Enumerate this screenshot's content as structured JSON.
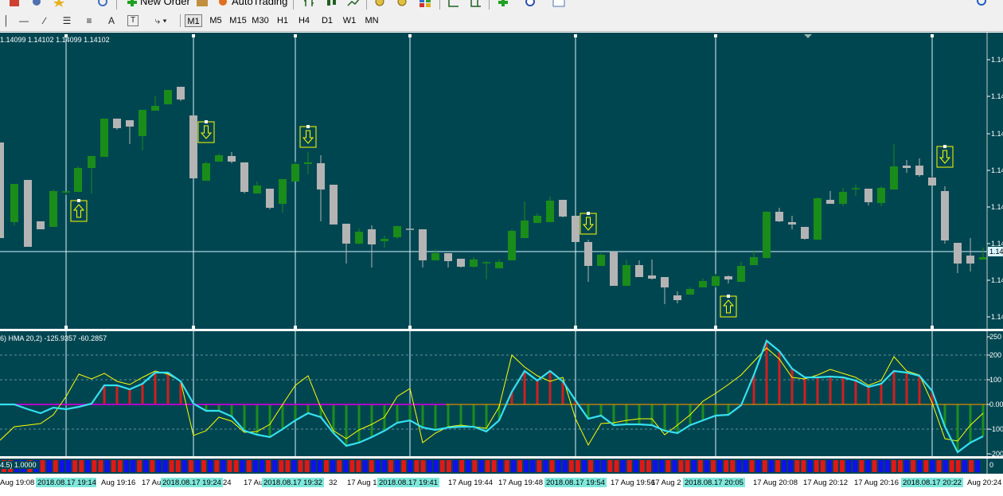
{
  "toolbar_top": {
    "new_order_label": "New Order",
    "auto_trading_label": "AutoTrading"
  },
  "timeframes": [
    {
      "label": "M1",
      "active": true
    },
    {
      "label": "M5",
      "active": false
    },
    {
      "label": "M15",
      "active": false
    },
    {
      "label": "M30",
      "active": false
    },
    {
      "label": "H1",
      "active": false
    },
    {
      "label": "H4",
      "active": false
    },
    {
      "label": "D1",
      "active": false
    },
    {
      "label": "W1",
      "active": false
    },
    {
      "label": "MN",
      "active": false
    }
  ],
  "drawing_tools": [
    {
      "icon": "cursor-icon"
    },
    {
      "icon": "horizontal-line-icon"
    },
    {
      "icon": "trendline-icon"
    },
    {
      "icon": "equidistant-channel-icon"
    },
    {
      "icon": "fibonacci-icon"
    },
    {
      "icon": "text-icon",
      "glyph": "A"
    },
    {
      "icon": "text-label-icon",
      "glyph": "T"
    },
    {
      "icon": "arrows-icon"
    }
  ],
  "main_chart": {
    "ohlc_label": "1.14099 1.14102 1.14099 1.14102",
    "price_labels": [
      "1.14",
      "1.14",
      "1.14",
      "1.14",
      "1.14",
      "1.14",
      "1.14",
      "1.14"
    ],
    "current_price_label": "1.14",
    "colors": {
      "background": "#004651",
      "bull": "#1a8c1a",
      "bear": "#b4b4b4",
      "arrow": "#ffff00",
      "line": "#d8f4ff"
    }
  },
  "indicator": {
    "label": "6) HMA 20,2) -125.9357 -60.2857",
    "levels": [
      "250",
      "200",
      "100",
      "0.00",
      "-100",
      "-200"
    ],
    "colors": {
      "hma": "#35e0f0",
      "signal": "#ffff00",
      "hist_up": "#d21e1e",
      "hist_down": "#1e8c1e",
      "zero": "#b000c8"
    }
  },
  "bars_indicator": {
    "label": "4.5) 1.0000",
    "right_label": "0",
    "colors": {
      "red": "#e01818",
      "blue": "#1010ee"
    }
  },
  "time_axis": [
    {
      "label": "Aug 19:08",
      "highlight": false
    },
    {
      "label": "2018.08.17 19:14",
      "highlight": true
    },
    {
      "label": "Aug 19:16",
      "highlight": false
    },
    {
      "label": "17 Au",
      "highlight": false
    },
    {
      "label": "2018.08.17 19:24",
      "highlight": true
    },
    {
      "label": "24",
      "highlight": false
    },
    {
      "label": "17 Aug",
      "highlight": false
    },
    {
      "label": "2018.08.17 19:32",
      "highlight": true
    },
    {
      "label": "32",
      "highlight": false
    },
    {
      "label": "17 Aug 1",
      "highlight": false
    },
    {
      "label": "2018.08.17 19:41",
      "highlight": true
    },
    {
      "label": "17 Aug 19:44",
      "highlight": false
    },
    {
      "label": "17 Aug 19:48",
      "highlight": false
    },
    {
      "label": "2018.08.17 19:54",
      "highlight": true
    },
    {
      "label": "17 Aug 19:56",
      "highlight": false
    },
    {
      "label": "17 Aug 2",
      "highlight": false
    },
    {
      "label": "2018.08.17 20:05",
      "highlight": true
    },
    {
      "label": "17 Aug 20:08",
      "highlight": false
    },
    {
      "label": "17 Aug 20:12",
      "highlight": false
    },
    {
      "label": "17 Aug 20:16",
      "highlight": false
    },
    {
      "label": "2018.08.17 20:22",
      "highlight": true
    },
    {
      "label": "Aug 20:24",
      "highlight": false
    }
  ]
}
